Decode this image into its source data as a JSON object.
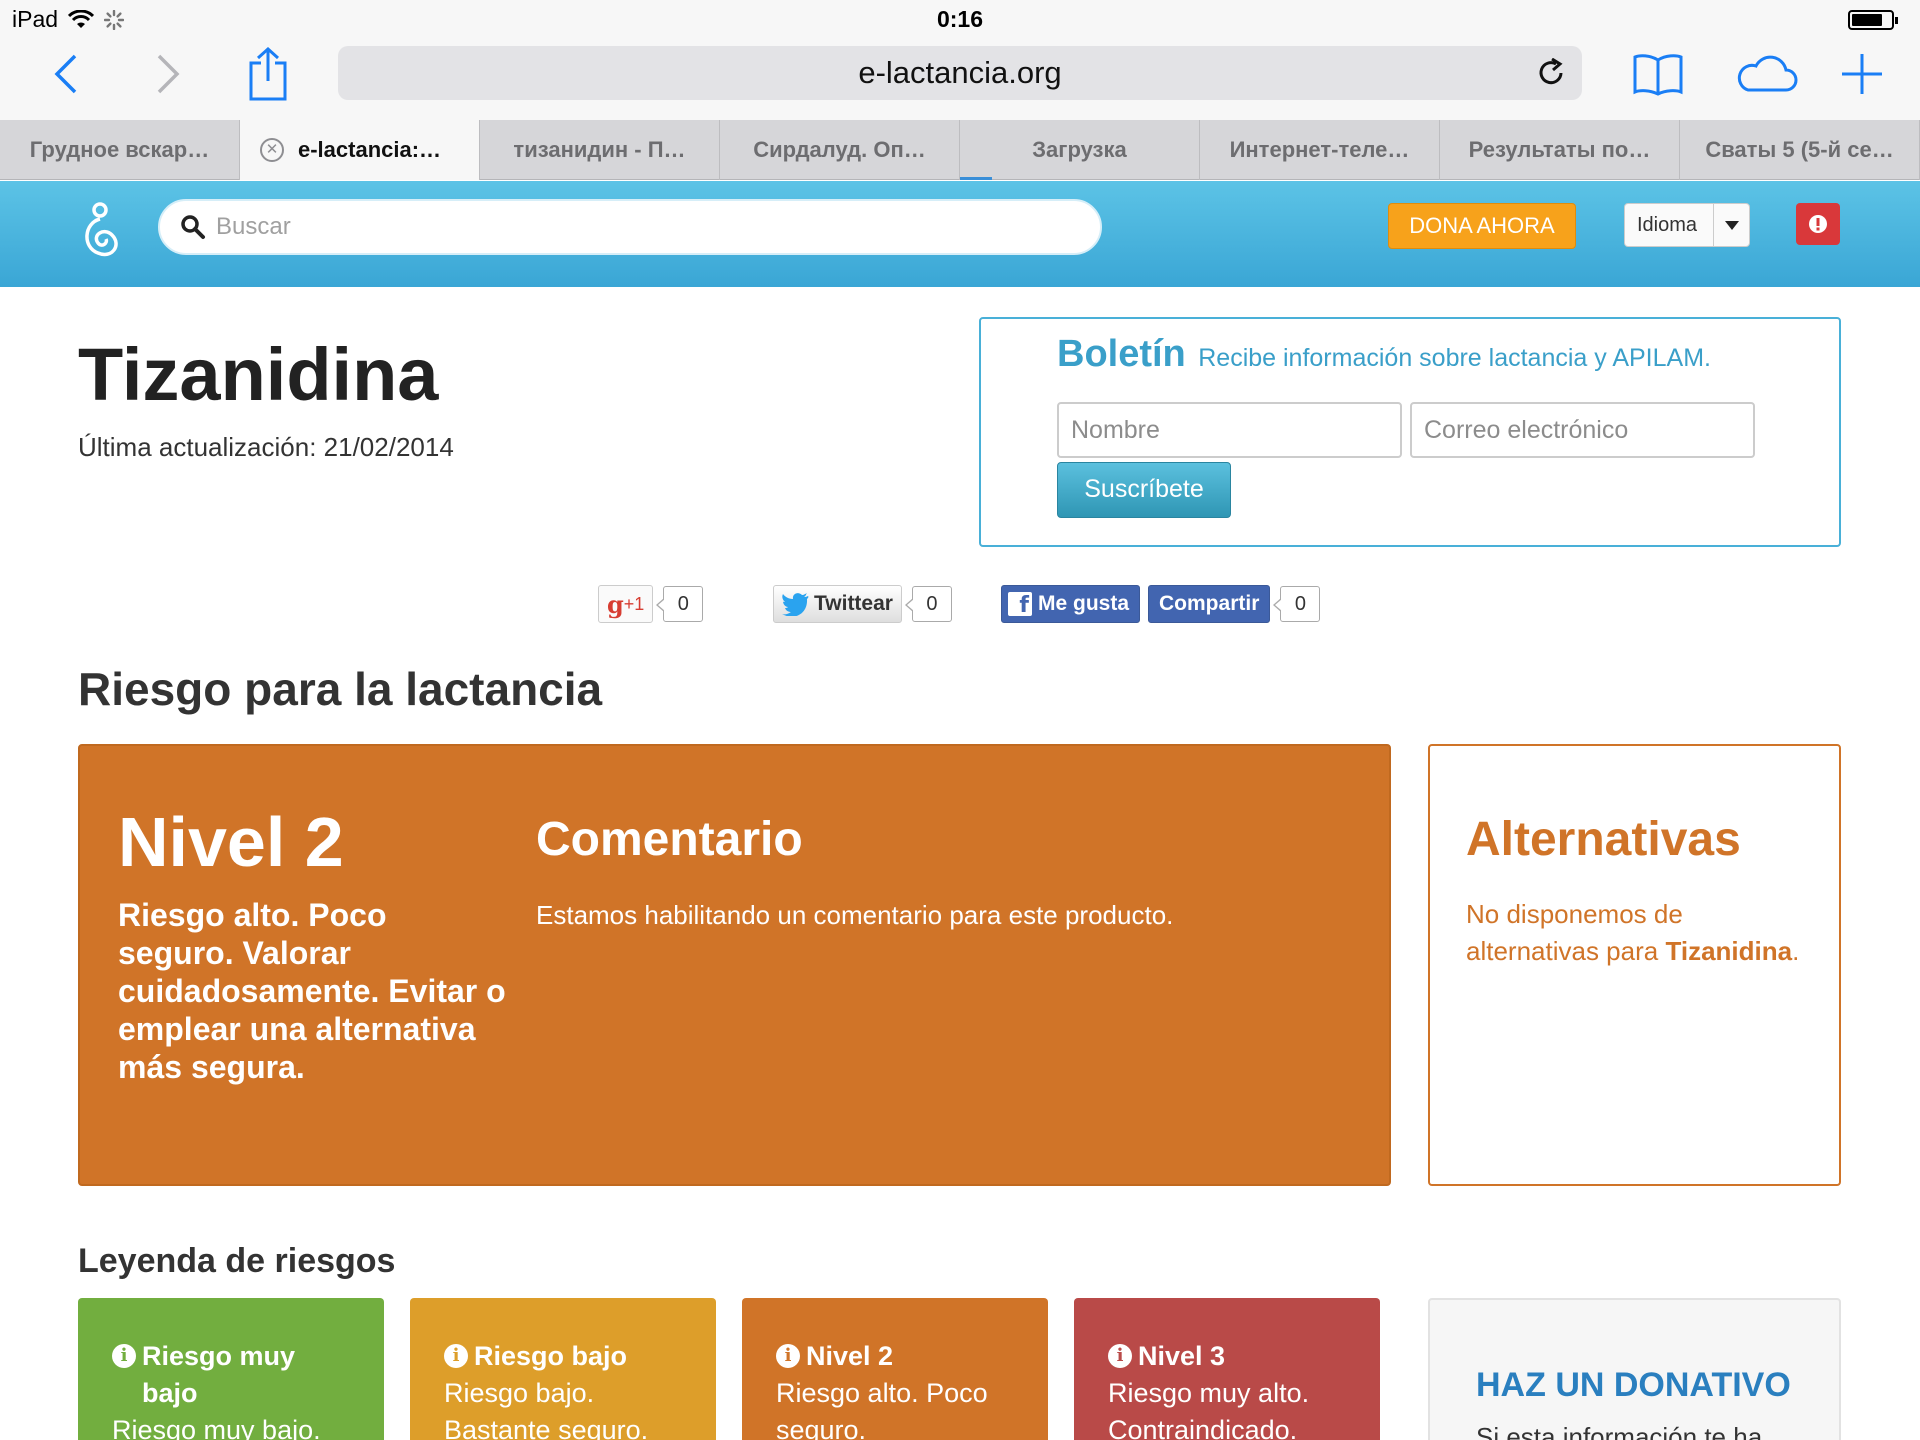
{
  "status_bar": {
    "device": "iPad",
    "time": "0:16",
    "battery_level": 0.8
  },
  "browser": {
    "url": "e-lactancia.org",
    "tabs": [
      {
        "label": "Грудное вскар…"
      },
      {
        "label": "e-lactancia:…"
      },
      {
        "label": "тизанидин - П…"
      },
      {
        "label": "Сирдалуд. Оп…"
      },
      {
        "label": "Загрузка"
      },
      {
        "label": "Интернет-теле…"
      },
      {
        "label": "Результаты по…"
      },
      {
        "label": "Сваты 5 (5-й се…"
      }
    ]
  },
  "header": {
    "search_placeholder": "Buscar",
    "donate_label": "DONA AHORA",
    "language_label": "Idioma",
    "donate_color": "#f7a21b"
  },
  "product": {
    "title": "Tizanidina",
    "updated": "Última actualización: 21/02/2014"
  },
  "newsletter": {
    "title": "Boletín",
    "subtitle": "Recibe información sobre lactancia y APILAM.",
    "name_placeholder": "Nombre",
    "email_placeholder": "Correo electrónico",
    "submit_label": "Suscríbete"
  },
  "social": {
    "gplus_label": "+1",
    "gplus_count": "0",
    "twitter_label": "Twittear",
    "twitter_count": "0",
    "like_label": "Me gusta",
    "share_label": "Compartir",
    "facebook_count": "0"
  },
  "risk": {
    "heading": "Riesgo para la lactancia",
    "level": "Nivel 2",
    "description": "Riesgo alto. Poco seguro. Valorar cuidadosamente. Evitar o emplear una alternativa más segura.",
    "comment_title": "Comentario",
    "comment_text": "Estamos habilitando un comentario para este producto.",
    "color": "#d07428"
  },
  "alternatives": {
    "title": "Alternativas",
    "text_before": "No disponemos de alternativas para ",
    "product": "Tizanidina",
    "text_after": "."
  },
  "legend": {
    "heading": "Leyenda de riesgos",
    "items": [
      {
        "title": "Riesgo muy bajo",
        "desc": "Riesgo muy bajo.",
        "color": "#72ae3f"
      },
      {
        "title": "Riesgo bajo",
        "desc": "Riesgo bajo. Bastante seguro.",
        "color": "#dd9e2a"
      },
      {
        "title": "Nivel 2",
        "desc": "Riesgo alto. Poco seguro.",
        "color": "#d07428"
      },
      {
        "title": "Nivel 3",
        "desc": "Riesgo muy alto. Contraindicado.",
        "color": "#b94a48"
      }
    ]
  },
  "donation": {
    "title": "HAZ UN DONATIVO",
    "text": "Si esta información te ha"
  }
}
